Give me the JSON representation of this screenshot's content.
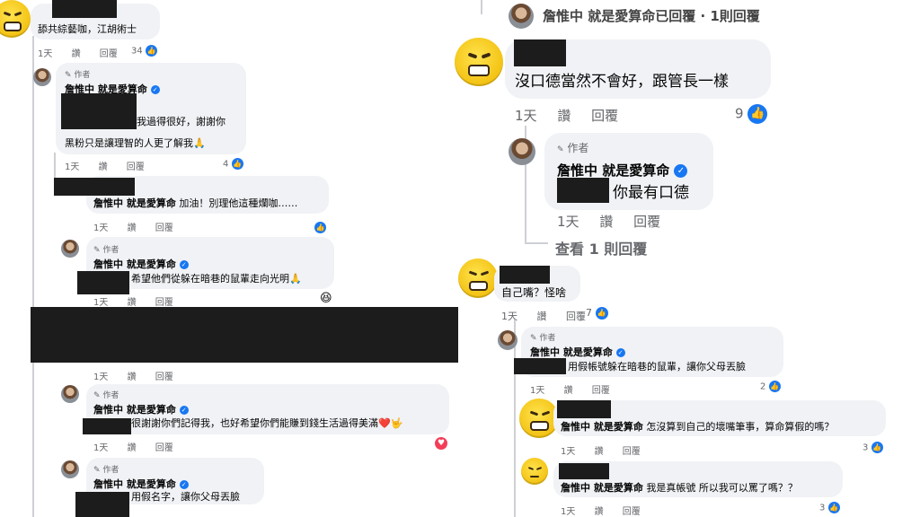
{
  "left": {
    "top_comment": {
      "text": "舔共綜藝咖，江胡術士",
      "time": "1天",
      "like": "讚",
      "reply": "回覆",
      "likes": "34"
    },
    "reply1": {
      "author_badge": "作者",
      "name": "詹惟中 就是愛算命",
      "line1": "我過得很好，謝謝你",
      "line2": "黑粉只是讓理智的人更了解我🙏",
      "time": "1天",
      "like": "讚",
      "reply": "回覆",
      "likes": "4"
    },
    "comment2": {
      "name": "詹惟中 就是愛算命",
      "text": "加油！別理他這種爛咖……",
      "time": "1天",
      "like": "讚",
      "reply": "回覆"
    },
    "reply2": {
      "author_badge": "作者",
      "name": "詹惟中 就是愛算命",
      "text": "希望他們從躲在暗巷的鼠輩走向光明🙏",
      "time": "1天",
      "like": "讚",
      "reply": "回覆"
    },
    "comment3": {
      "time": "1天",
      "like": "讚",
      "reply": "回覆"
    },
    "reply3": {
      "author_badge": "作者",
      "name": "詹惟中 就是愛算命",
      "text": "很謝謝你們記得我，也好希望你們能賺到錢生活過得美滿❤️🤟",
      "time": "1天",
      "like": "讚",
      "reply": "回覆"
    },
    "reply4": {
      "author_badge": "作者",
      "name": "詹惟中 就是愛算命",
      "text": "用假名字，讓你父母丟臉"
    }
  },
  "right": {
    "replied_header": "詹惟中 就是愛算命已回覆 · 1則回覆",
    "comment1": {
      "text": "沒口德當然不會好，跟管長一樣",
      "time": "1天",
      "like": "讚",
      "reply": "回覆",
      "likes": "9"
    },
    "reply1": {
      "author_badge": "作者",
      "name": "詹惟中 就是愛算命",
      "text": "你最有口德",
      "time": "1天",
      "like": "讚",
      "reply": "回覆"
    },
    "view_more": "查看 1 則回覆",
    "comment2": {
      "text": "自己嘴？怪啥",
      "time": "1天",
      "like": "讚",
      "reply": "回覆",
      "likes": "7"
    },
    "reply2": {
      "author_badge": "作者",
      "name": "詹惟中 就是愛算命",
      "text": "用假帳號躲在暗巷的鼠輩，讓你父母丟臉",
      "time": "1天",
      "like": "讚",
      "reply": "回覆",
      "likes": "2"
    },
    "reply3": {
      "name": "詹惟中 就是愛算命",
      "text": "怎沒算到自己的壞嘴筆事，算命算假的嗎？",
      "time": "1天",
      "like": "讚",
      "reply": "回覆",
      "likes": "3"
    },
    "reply4": {
      "name": "詹惟中 就是愛算命",
      "text": "我是真帳號 所以我可以罵了嗎？？",
      "time": "1天",
      "like": "讚",
      "reply": "回覆",
      "likes": "3"
    }
  },
  "icons": {
    "like": "thumbs-up-icon",
    "verified": "verified-check-icon",
    "pencil": "pencil-icon",
    "emoji": "angry-grin-emoji-icon"
  },
  "colors": {
    "bubble": "#f0f2f5",
    "accent": "#1877f2",
    "redaction": "#1c1c1c"
  }
}
